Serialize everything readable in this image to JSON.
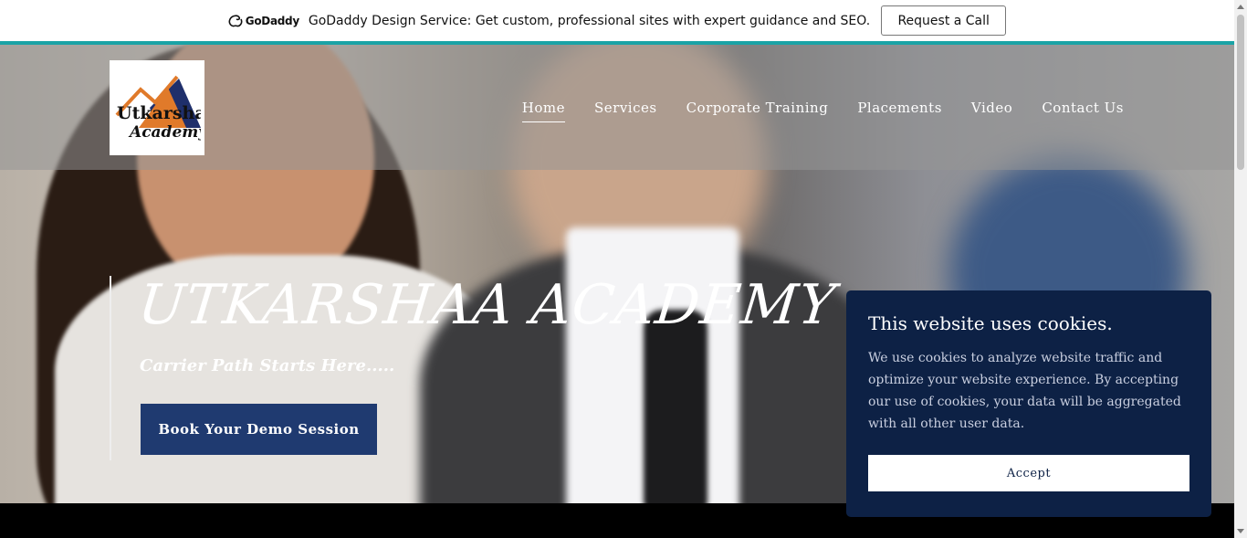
{
  "promo": {
    "brand": "GoDaddy",
    "text": "GoDaddy Design Service: Get custom, professional sites with expert guidance and SEO.",
    "button": "Request a Call"
  },
  "logo": {
    "line1": "Utkarshaa",
    "line2": "Academy"
  },
  "nav": {
    "items": [
      {
        "label": "Home",
        "active": true
      },
      {
        "label": "Services"
      },
      {
        "label": "Corporate Training"
      },
      {
        "label": "Placements"
      },
      {
        "label": "Video"
      },
      {
        "label": "Contact Us"
      }
    ]
  },
  "hero": {
    "title": "UTKARSHAA ACADEMY",
    "subtitle": "Carrier Path Starts Here.....",
    "cta": "Book Your Demo Session"
  },
  "cookie": {
    "title": "This website uses cookies.",
    "text": "We use cookies to analyze website traffic and optimize your website experience. By accepting our use of cookies, your data will be aggregated with all other user data.",
    "accept": "Accept"
  },
  "colors": {
    "accent_teal": "#1aa3a6",
    "cta_blue": "#1f3a70",
    "cookie_bg": "#0d2145"
  }
}
